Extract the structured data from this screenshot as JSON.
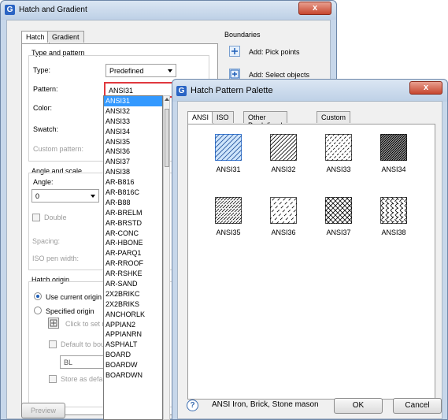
{
  "main": {
    "title": "Hatch and Gradient",
    "close_label": "x",
    "tabs": [
      "Hatch",
      "Gradient"
    ],
    "type_and_pattern": {
      "heading": "Type and pattern",
      "type_label": "Type:",
      "type_value": "Predefined",
      "pattern_label": "Pattern:",
      "pattern_value": "ANSI31",
      "color_label": "Color:",
      "swatch_label": "Swatch:",
      "custom_pattern_label": "Custom pattern:"
    },
    "angle_and_scale": {
      "heading": "Angle and scale",
      "angle_label": "Angle:",
      "angle_value": "0",
      "double_label": "Double",
      "spacing_label": "Spacing:",
      "iso_pen_label": "ISO pen width:"
    },
    "hatch_origin": {
      "heading": "Hatch origin",
      "use_current_label": "Use current origin",
      "specified_label": "Specified origin",
      "click_to_set_label": "Click to set n",
      "default_boundary_label": "Default to bounc",
      "position_value": "BL",
      "store_default_label": "Store as default"
    },
    "boundaries": {
      "heading": "Boundaries",
      "pick_points_label": "Add: Pick points",
      "select_objects_label": "Add: Select objects"
    },
    "preview_label": "Preview",
    "pattern_list": [
      "ANSI31",
      "ANSI32",
      "ANSI33",
      "ANSI34",
      "ANSI35",
      "ANSI36",
      "ANSI37",
      "ANSI38",
      "AR-B816",
      "AR-B816C",
      "AR-B88",
      "AR-BRELM",
      "AR-BRSTD",
      "AR-CONC",
      "AR-HBONE",
      "AR-PARQ1",
      "AR-RROOF",
      "AR-RSHKE",
      "AR-SAND",
      "2X2BRIKC",
      "2X2BRIKS",
      "ANCHORLK",
      "APPIAN2",
      "APPIANRN",
      "ASPHALT",
      "BOARD",
      "BOARDW",
      "BOARDWN"
    ],
    "pattern_selected_index": 0
  },
  "palette": {
    "title": "Hatch Pattern Palette",
    "close_label": "x",
    "tabs": [
      "ANSI",
      "ISO",
      "Other Predefined",
      "Custom"
    ],
    "patterns": [
      {
        "name": "ANSI31",
        "icon": "hatch-ansi31-icon"
      },
      {
        "name": "ANSI32",
        "icon": "hatch-ansi32-icon"
      },
      {
        "name": "ANSI33",
        "icon": "hatch-ansi33-icon"
      },
      {
        "name": "ANSI34",
        "icon": "hatch-ansi34-icon"
      },
      {
        "name": "ANSI35",
        "icon": "hatch-ansi35-icon"
      },
      {
        "name": "ANSI36",
        "icon": "hatch-ansi36-icon"
      },
      {
        "name": "ANSI37",
        "icon": "hatch-ansi37-icon"
      },
      {
        "name": "ANSI38",
        "icon": "hatch-ansi38-icon"
      }
    ],
    "selected_pattern": "ANSI31",
    "description": "ANSI Iron, Brick, Stone mason",
    "ok_label": "OK",
    "cancel_label": "Cancel"
  },
  "colors": {
    "titlebar": "#c7d7ea",
    "selection": "#3399ff",
    "pattern_highlight_border": "#e0393e",
    "selected_swatch_fill": "#cfe5fb"
  }
}
